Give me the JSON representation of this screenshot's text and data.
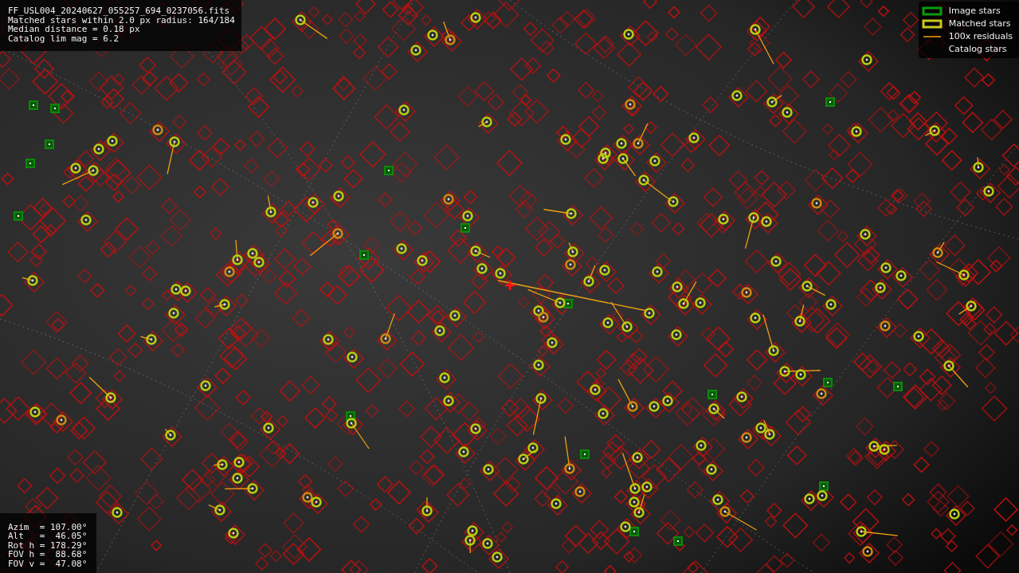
{
  "info_panel": {
    "lines": [
      "FF_USL004_20240627_055257_694_0237056.fits",
      "Matched stars within 2.0 px radius: 164/184",
      "Median distance = 0.18 px",
      "Catalog lim mag = 6.2"
    ]
  },
  "legend": [
    {
      "kind": "image",
      "label": "Image stars"
    },
    {
      "kind": "matched",
      "label": "Matched stars"
    },
    {
      "kind": "residual",
      "label": "100x residuals"
    },
    {
      "kind": "catalog",
      "label": "Catalog stars"
    }
  ],
  "pointing_panel": {
    "lines": [
      "Azim  = 107.00°",
      "Alt   =  46.05°",
      "Rot h = 178.29°",
      "FOV h =  88.68°",
      "FOV v =  47.08°"
    ]
  }
}
